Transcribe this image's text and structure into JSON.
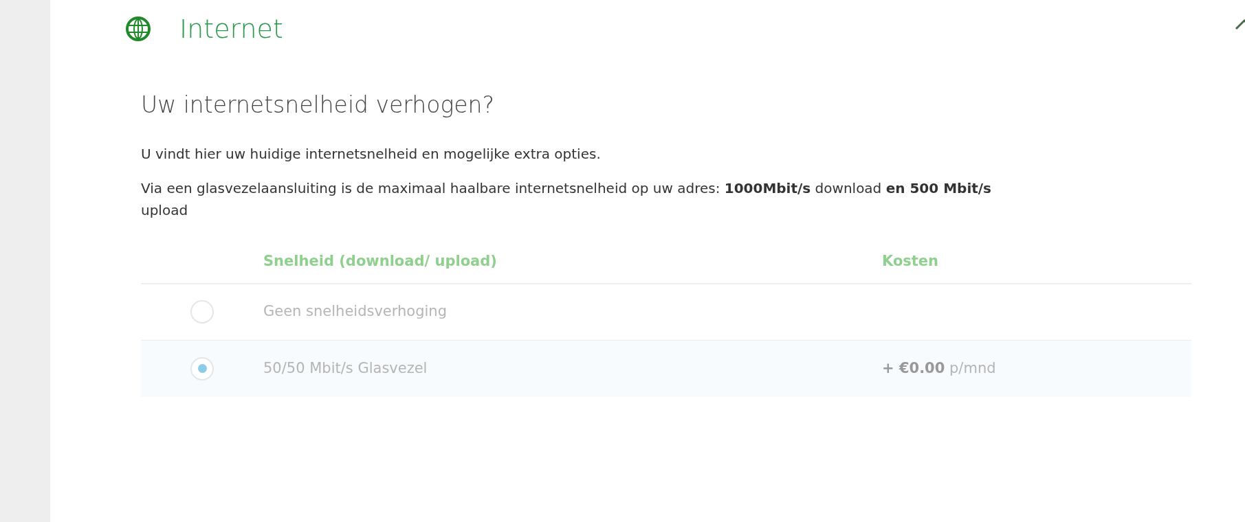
{
  "section": {
    "title": "Internet",
    "expanded": true
  },
  "heading": "Uw internetsnelheid verhogen?",
  "paragraphs": [
    "U vindt hier uw huidige internetsnelheid en mogelijke extra opties.",
    "Via een glasvezelaansluiting is de maximaal haalbare internetsnelheid op uw adres: **1000Mbit/s** download **en 500 Mbit/s** upload"
  ],
  "table": {
    "columns": [
      "Snelheid (download/ upload)",
      "Kosten"
    ],
    "rows": [
      {
        "speed": "Geen snelheidsverhoging",
        "selected": false
      },
      {
        "speed": "50/50 Mbit/s Glasvezel",
        "cost": "**+ €0.00** p/mnd",
        "selected": true
      }
    ]
  }
}
